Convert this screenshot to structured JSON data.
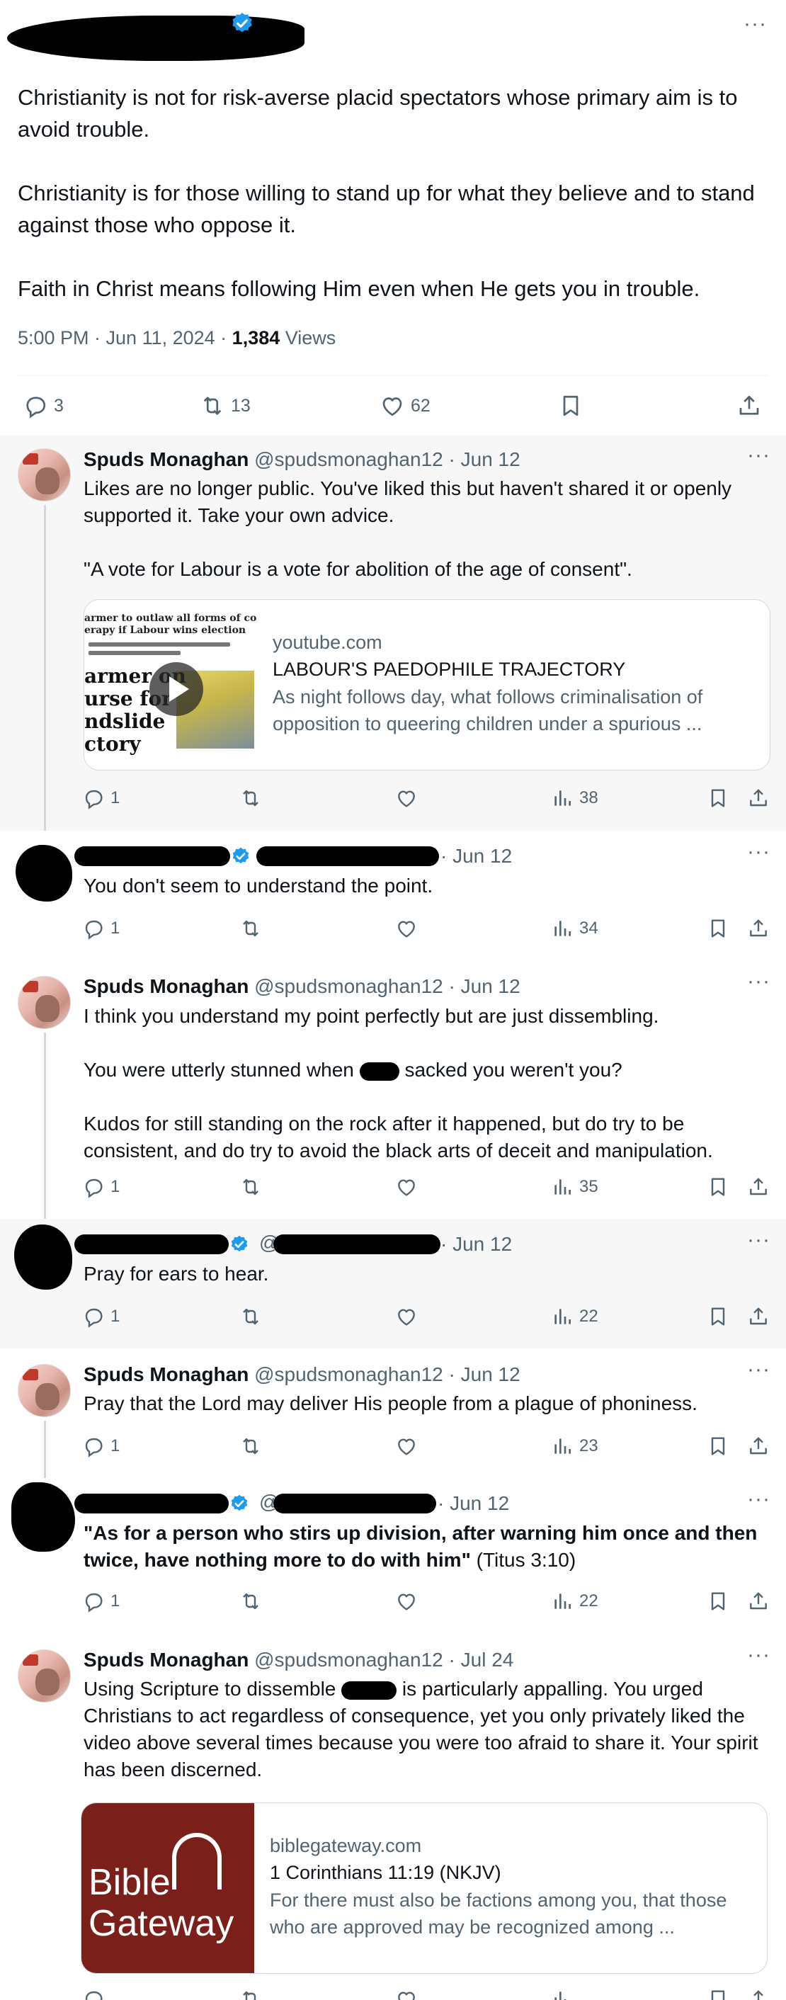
{
  "main_post": {
    "paragraphs": [
      "Christianity is not for risk-averse placid spectators whose primary aim is to avoid trouble.",
      "Christianity is for those willing to stand up for what they believe and to stand against those who oppose it.",
      "Faith in Christ means following Him even when He gets you in trouble."
    ],
    "timestamp": "5:00 PM · Jun 11, 2024 · ",
    "views_count": "1,384",
    "views_label": " Views",
    "stats": {
      "replies": "3",
      "reposts": "13",
      "likes": "62"
    }
  },
  "replies": [
    {
      "name": "Spuds Monaghan",
      "handle": "@spudsmonaghan12",
      "time": "· Jun 12",
      "paragraphs": [
        "Likes are no longer public. You've liked this but haven't shared it or openly supported it. Take your own advice.",
        "\"A vote for Labour is a vote for abolition of the age of consent\"."
      ],
      "card": {
        "domain": "youtube.com",
        "title": "LABOUR'S PAEDOPHILE TRAJECTORY",
        "desc": "As night follows day, what follows criminalisation of opposition to queering children under a spurious ...",
        "thumb_lines": [
          "armer to outlaw all forms of conversion",
          "erapy if Labour wins election"
        ],
        "thumb_big": [
          "armer on",
          "urse for",
          "ndslide",
          "ctory"
        ]
      },
      "stats": {
        "replies": "1",
        "views": "38"
      }
    },
    {
      "time": "· Jun 12",
      "paragraphs": [
        "You don't seem to understand the point."
      ],
      "stats": {
        "replies": "1",
        "views": "34"
      }
    },
    {
      "name": "Spuds Monaghan",
      "handle": "@spudsmonaghan12",
      "time": "· Jun 12",
      "p1": "I think you understand my point perfectly but are just dissembling.",
      "p2_before": "You were utterly stunned when ",
      "p2_after": " sacked you weren't you?",
      "p3": "Kudos for still standing on the rock after it happened, but do try to be consistent, and do try to avoid the black arts of deceit and manipulation.",
      "stats": {
        "replies": "1",
        "views": "35"
      }
    },
    {
      "handle_prefix": "@",
      "time": "· Jun 12",
      "paragraphs": [
        "Pray for ears to hear."
      ],
      "stats": {
        "replies": "1",
        "views": "22"
      }
    },
    {
      "name": "Spuds Monaghan",
      "handle": "@spudsmonaghan12",
      "time": "· Jun 12",
      "paragraphs": [
        "Pray that the Lord may deliver His people from a plague of phoniness."
      ],
      "stats": {
        "replies": "1",
        "views": "23"
      }
    },
    {
      "handle_prefix": "@",
      "time": "· Jun 12",
      "quote_bold": "\"As for a person who stirs up division, after warning him once and then twice, have nothing more to do with him\"",
      "quote_ref": " (Titus 3:10)",
      "stats": {
        "replies": "1",
        "views": "22"
      }
    },
    {
      "name": "Spuds Monaghan",
      "handle": "@spudsmonaghan12",
      "time": "· Jul 24",
      "text_before": "Using Scripture to dissemble ",
      "text_after": " is particularly appalling. You urged Christians to act regardless of consequence, yet you only privately liked the video above several times because you were too afraid to share it. Your spirit has been discerned.",
      "card": {
        "domain": "biblegateway.com",
        "title": "1 Corinthians 11:19 (NKJV)",
        "desc": "For there must also be factions among you, that those who are approved may be recognized among ...",
        "logo_line1": "Bible",
        "logo_line2": "Gateway"
      }
    }
  ],
  "colors": {
    "text": "#0f1419",
    "muted": "#536471",
    "verified": "#1d9bf0",
    "shaded_bg": "#f7f7f7",
    "thread_line": "#cfd9de"
  }
}
